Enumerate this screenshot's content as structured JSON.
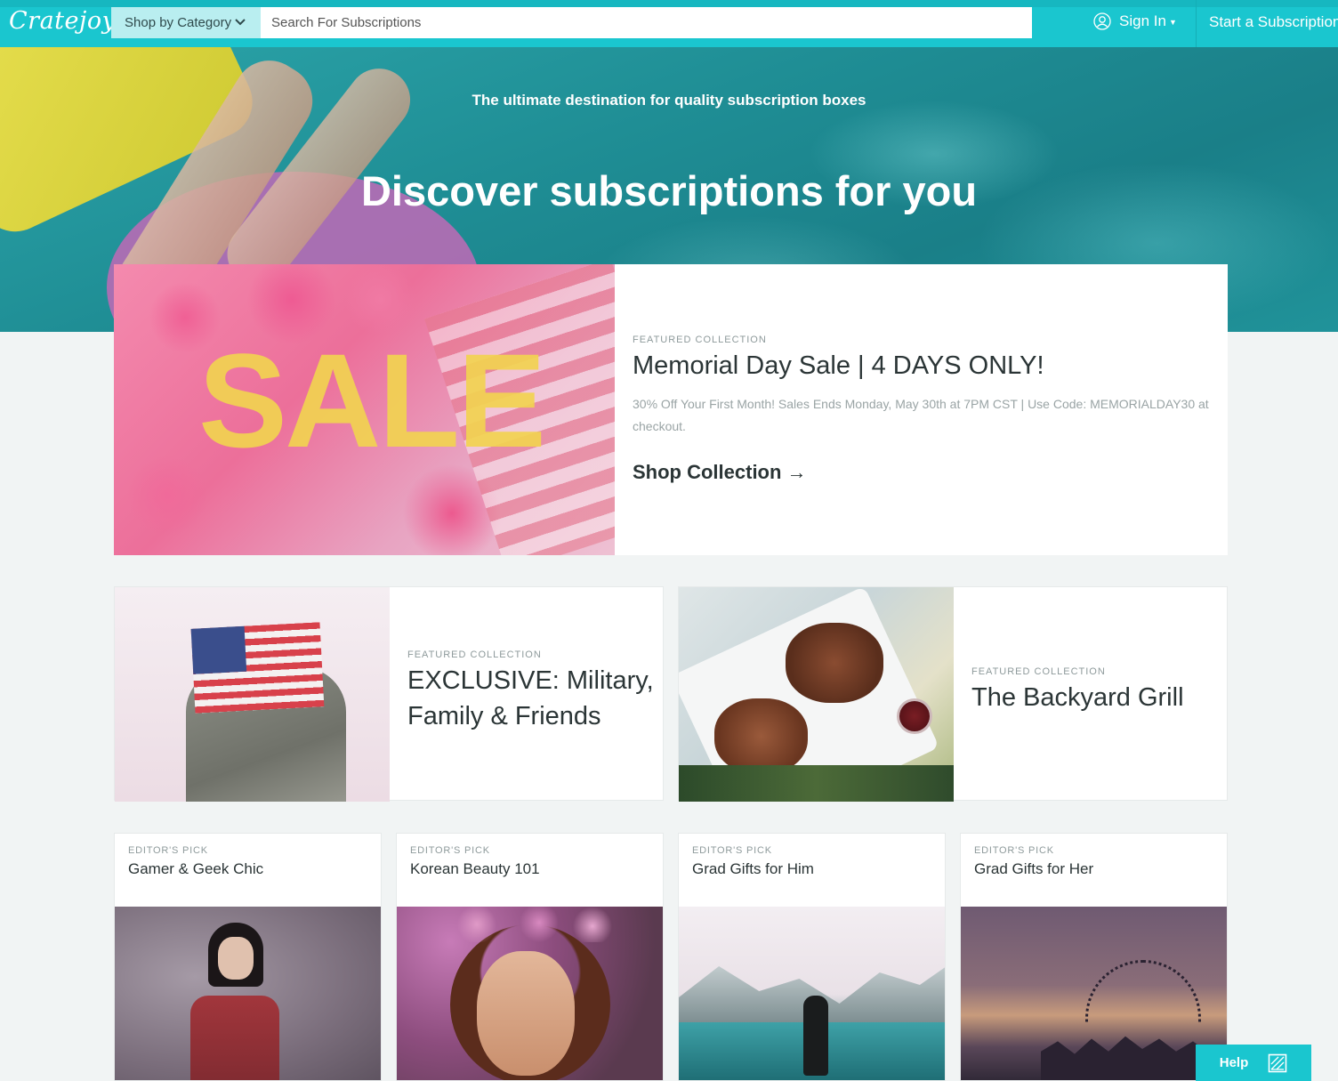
{
  "brand": {
    "logo_text": "Cratejoy",
    "accent": "#1ac6cf"
  },
  "nav": {
    "category_label": "Shop by Category",
    "search_placeholder": "Search For Subscriptions",
    "signin_label": "Sign In",
    "start_label": "Start a Subscription"
  },
  "hero": {
    "tagline": "The ultimate destination for quality subscription boxes",
    "title": "Discover subscriptions for you"
  },
  "featured_main": {
    "eyebrow": "FEATURED COLLECTION",
    "image_text": "SALE",
    "title": "Memorial Day Sale | 4 DAYS ONLY!",
    "description": "30% Off Your First Month! Sales Ends Monday, May 30th at 7PM CST | Use Code: MEMORIALDAY30 at checkout.",
    "cta": "Shop Collection",
    "cta_arrow": "→"
  },
  "featured_cards": [
    {
      "eyebrow": "FEATURED COLLECTION",
      "title": "EXCLUSIVE: Military, Family & Friends"
    },
    {
      "eyebrow": "FEATURED COLLECTION",
      "title": "The Backyard Grill"
    }
  ],
  "editor_picks": [
    {
      "eyebrow": "EDITOR'S PICK",
      "title": "Gamer & Geek Chic"
    },
    {
      "eyebrow": "EDITOR'S PICK",
      "title": "Korean Beauty 101"
    },
    {
      "eyebrow": "EDITOR'S PICK",
      "title": "Grad Gifts for Him"
    },
    {
      "eyebrow": "EDITOR'S PICK",
      "title": "Grad Gifts for Her"
    }
  ],
  "help": {
    "label": "Help",
    "icon": "help-widget-icon"
  }
}
